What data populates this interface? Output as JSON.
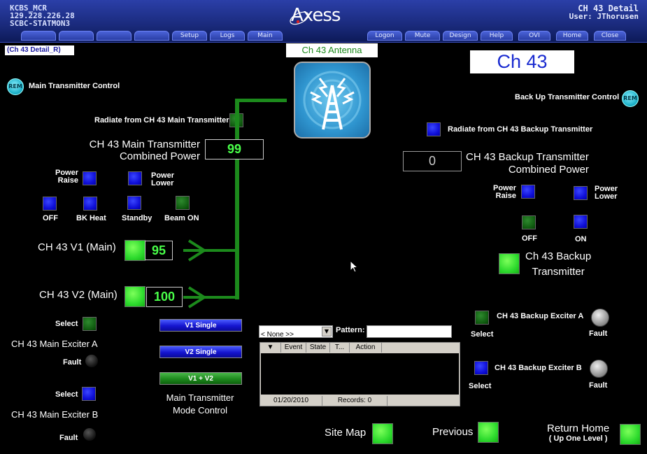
{
  "header": {
    "station": "KCBS_MCR",
    "ip": "129.228.226.28",
    "host": "SCBC-STATMON3",
    "logo": "Axess",
    "page_title": "CH 43 Detail",
    "user": "User: JThorusen",
    "nav_left": [
      "",
      "",
      "",
      "",
      "Setup",
      "Logs",
      "Main"
    ],
    "nav_right": [
      "Logon",
      "Mute",
      "Design",
      "Help",
      "OVI",
      "Home",
      "Close"
    ]
  },
  "detail_tag": "(Ch 43 Detail_R)",
  "antenna_label": "Ch 43 Antenna",
  "channel_title": "Ch 43",
  "main": {
    "rem": "REM",
    "control_label": "Main Transmitter Control",
    "radiate_label": "Radiate from CH 43 Main Transmitter",
    "combined_power_label_1": "CH 43 Main Transmitter",
    "combined_power_label_2": "Combined Power",
    "combined_power_value": "99",
    "power_raise": "Power\nRaise",
    "power_lower": "Power\nLower",
    "off": "OFF",
    "bk_heat": "BK Heat",
    "standby": "Standby",
    "beam_on": "Beam ON",
    "v1_label": "CH 43 V1 (Main)",
    "v1_value": "95",
    "v2_label": "CH 43 V2 (Main)",
    "v2_value": "100",
    "exciter_a_select": "Select",
    "exciter_a_label": "CH 43 Main Exciter A",
    "exciter_a_fault": "Fault",
    "exciter_b_select": "Select",
    "exciter_b_label": "CH 43 Main Exciter B",
    "exciter_b_fault": "Fault",
    "mode_v1": "V1 Single",
    "mode_v2": "V2 Single",
    "mode_v1v2": "V1 + V2",
    "mode_label_1": "Main Transmitter",
    "mode_label_2": "Mode Control"
  },
  "backup": {
    "rem": "REM",
    "control_label": "Back Up Transmitter Control",
    "radiate_label": "Radiate from CH 43 Backup Transmitter",
    "combined_power_value": "0",
    "combined_power_label_1": "CH 43 Backup Transmitter",
    "combined_power_label_2": "Combined Power",
    "power_raise": "Power\nRaise",
    "power_lower": "Power\nLower",
    "off": "OFF",
    "on": "ON",
    "tx_label_1": "Ch 43 Backup",
    "tx_label_2": "Transmitter",
    "exciter_a_label": "CH 43 Backup Exciter A",
    "exciter_a_select": "Select",
    "exciter_a_fault": "Fault",
    "exciter_b_label": "CH 43 Backup Exciter B",
    "exciter_b_select": "Select",
    "exciter_b_fault": "Fault"
  },
  "event_panel": {
    "filter_value": "< None >>",
    "pattern_label": "Pattern:",
    "pattern_value": "",
    "columns": [
      "",
      "Event",
      "State",
      "T...",
      "Action"
    ],
    "date": "01/20/2010",
    "records": "Records: 0"
  },
  "footer": {
    "site_map": "Site Map",
    "previous": "Previous",
    "return_home": "Return Home",
    "up_one_level": "( Up One Level )"
  },
  "colors": {
    "accent_green": "#2edb2e",
    "dark_green": "#0f5a0f",
    "blue": "#1010d8",
    "value_green": "#49ff49",
    "header_blue": "#1a2a7c"
  }
}
